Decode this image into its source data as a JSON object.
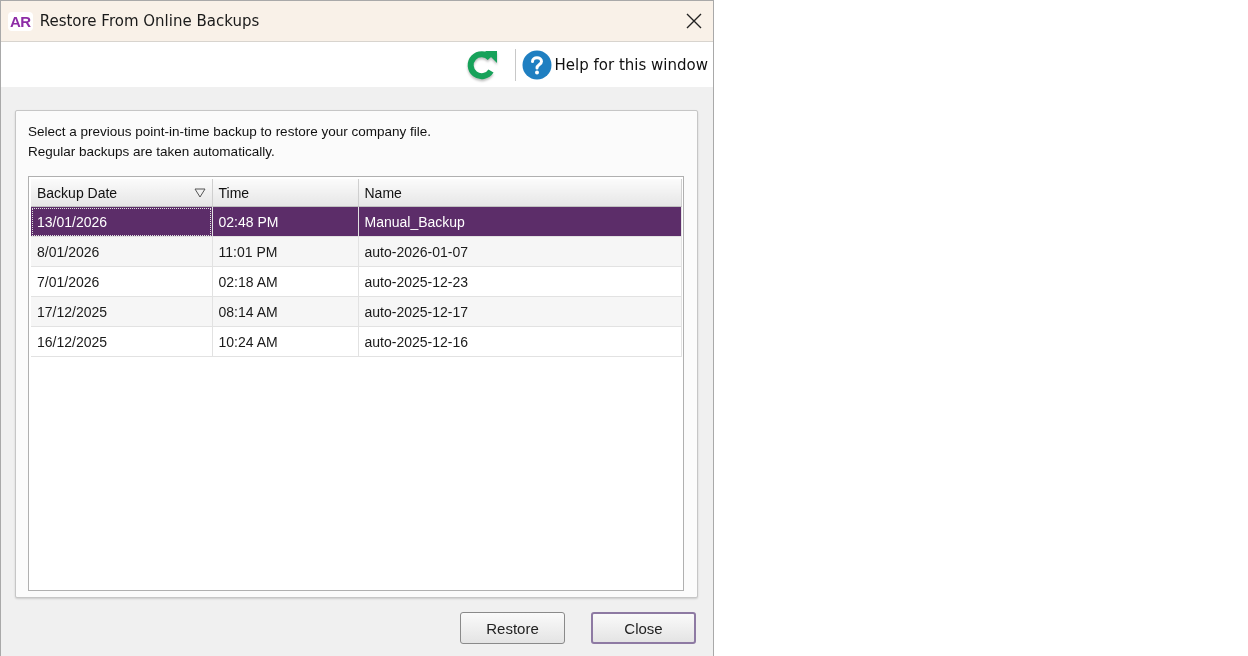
{
  "window": {
    "logo": "AR",
    "title": "Restore From Online Backups"
  },
  "toolbar": {
    "help_link": "Help for this window"
  },
  "instructions": [
    "Select a previous point-in-time backup to restore your company file.",
    "Regular backups are taken automatically."
  ],
  "table": {
    "columns": [
      {
        "label": "Backup Date",
        "sorted": true
      },
      {
        "label": "Time",
        "sorted": false
      },
      {
        "label": "Name",
        "sorted": false
      }
    ],
    "rows": [
      {
        "cells": [
          "13/01/2026",
          "02:48 PM",
          "Manual_Backup"
        ],
        "selected": true
      },
      {
        "cells": [
          "8/01/2026",
          "11:01 PM",
          "auto-2026-01-07"
        ],
        "selected": false
      },
      {
        "cells": [
          "7/01/2026",
          "02:18 AM",
          "auto-2025-12-23"
        ],
        "selected": false
      },
      {
        "cells": [
          "17/12/2025",
          "08:14 AM",
          "auto-2025-12-17"
        ],
        "selected": false
      },
      {
        "cells": [
          "16/12/2025",
          "10:24 AM",
          "auto-2025-12-16"
        ],
        "selected": false
      }
    ]
  },
  "buttons": [
    {
      "label": "Restore",
      "default": false
    },
    {
      "label": "Close",
      "default": true
    }
  ]
}
